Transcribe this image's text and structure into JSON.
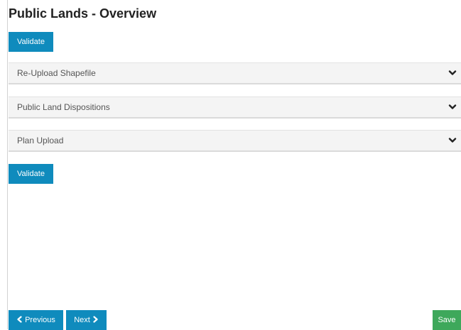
{
  "page": {
    "title": "Public Lands - Overview"
  },
  "actions": {
    "validate_label": "Validate",
    "previous_label": "Previous",
    "next_label": "Next",
    "save_label": "Save"
  },
  "accordion": {
    "items": [
      {
        "label": "Re-Upload Shapefile",
        "icon": "chevron-down-icon",
        "expanded": false
      },
      {
        "label": "Public Land Dispositions",
        "icon": "chevron-down-icon",
        "expanded": false
      },
      {
        "label": "Plan Upload",
        "icon": "chevron-down-icon",
        "expanded": false
      }
    ]
  },
  "icons": {
    "previous": "chevron-left-icon",
    "next": "chevron-right-icon"
  },
  "colors": {
    "primary": "#0f8bbd",
    "success": "#3ea85b",
    "panel_background": "#f4f4f4",
    "title_text": "#222222"
  }
}
